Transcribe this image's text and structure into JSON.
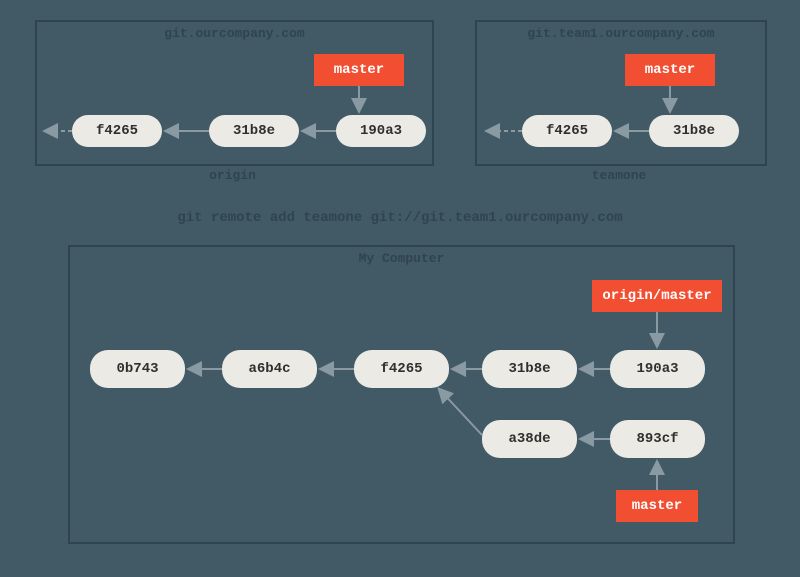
{
  "origin": {
    "title": "git.ourcompany.com",
    "caption": "origin",
    "branch": "master",
    "commits": [
      "f4265",
      "31b8e",
      "190a3"
    ]
  },
  "teamone": {
    "title": "git.team1.ourcompany.com",
    "caption": "teamone",
    "branch": "master",
    "commits": [
      "f4265",
      "31b8e"
    ]
  },
  "command": "git remote add teamone git://git.team1.ourcompany.com",
  "local": {
    "title": "My Computer",
    "branches": {
      "origin_master": "origin/master",
      "master": "master"
    },
    "commits": {
      "c0": "0b743",
      "c1": "a6b4c",
      "c2": "f4265",
      "c3": "31b8e",
      "c4": "190a3",
      "c5": "a38de",
      "c6": "893cf"
    }
  }
}
